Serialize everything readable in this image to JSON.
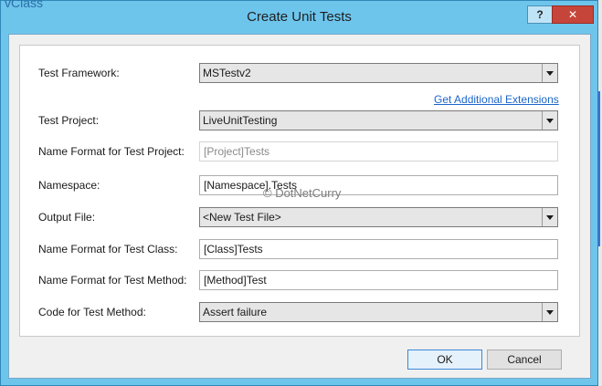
{
  "background": {
    "code_fragment": "vClass"
  },
  "dialog": {
    "title": "Create Unit Tests",
    "help_label": "?",
    "close_label": "✕",
    "watermark": "© DotNetCurry"
  },
  "form": {
    "test_framework": {
      "label": "Test Framework:",
      "value": "MSTestv2"
    },
    "extensions_link": "Get Additional Extensions",
    "test_project": {
      "label": "Test Project:",
      "value": "LiveUnitTesting"
    },
    "name_format_project": {
      "label": "Name Format for Test Project:",
      "value": "[Project]Tests"
    },
    "namespace": {
      "label": "Namespace:",
      "value": "[Namespace].Tests"
    },
    "output_file": {
      "label": "Output File:",
      "value": "<New Test File>"
    },
    "name_format_class": {
      "label": "Name Format for Test Class:",
      "value": "[Class]Tests"
    },
    "name_format_method": {
      "label": "Name Format for Test Method:",
      "value": "[Method]Test"
    },
    "code_for_method": {
      "label": "Code for Test Method:",
      "value": "Assert failure"
    }
  },
  "buttons": {
    "ok": "OK",
    "cancel": "Cancel"
  },
  "colors": {
    "title_bar": "#6ec5ec",
    "close_button": "#c6453b",
    "link": "#1b66c9"
  }
}
